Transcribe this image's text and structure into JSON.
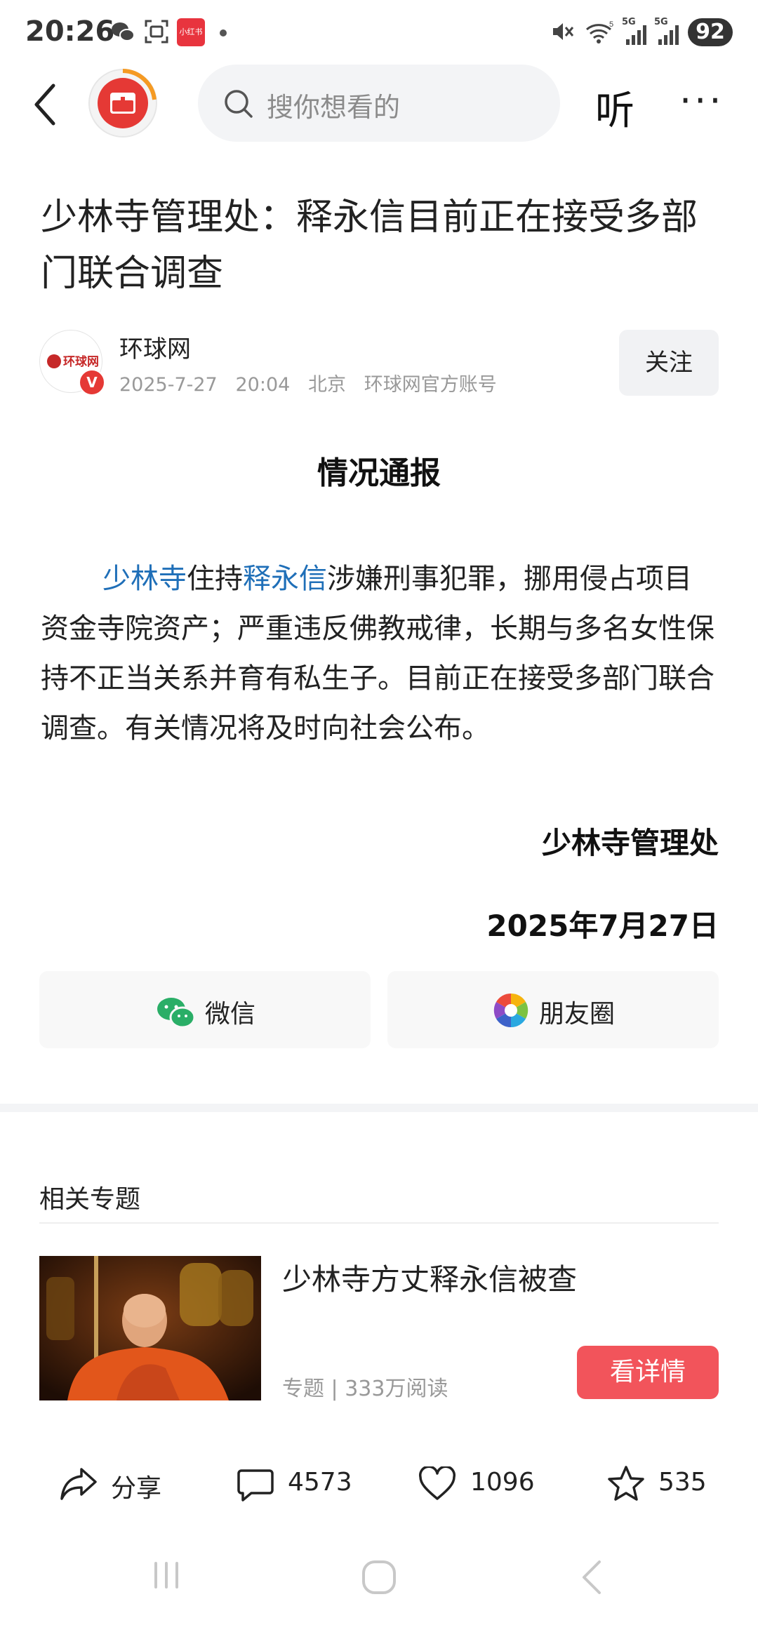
{
  "status_bar": {
    "time": "20:26",
    "app_badge": "小红书",
    "battery": "92",
    "signal_labels": [
      "5G",
      "5G"
    ],
    "icons": [
      "wechat-icon",
      "scan-icon",
      "xiaohongshu-icon",
      "dot-icon",
      "mute-icon",
      "wifi-icon",
      "signal-icon",
      "signal-icon",
      "battery-icon"
    ]
  },
  "top_nav": {
    "search_placeholder": "搜你想看的",
    "listen_label": "听",
    "more_label": "···"
  },
  "article": {
    "title": "少林寺管理处：释永信目前正在接受多部门联合调查",
    "author": {
      "name": "环球网",
      "logo_text": "环球网",
      "verified_badge": "V",
      "date": "2025-7-27",
      "time": "20:04",
      "location": "北京",
      "account_type": "环球网官方账号"
    },
    "follow_label": "关注",
    "heading": "情况通报",
    "paragraph": {
      "link1": "少林寺",
      "text1": "住持",
      "link2": "释永信",
      "text2": "涉嫌刑事犯罪，挪用侵占项目资金寺院资产；严重违反佛教戒律，长期与多名女性保持不正当关系并育有私生子。目前正在接受多部门联合调查。有关情况将及时向社会公布。"
    },
    "signature": "少林寺管理处",
    "sign_date": "2025年7月27日"
  },
  "share": {
    "wechat_label": "微信",
    "moments_label": "朋友圈"
  },
  "related": {
    "section_title": "相关专题",
    "topic_title": "少林寺方丈释永信被查",
    "topic_type": "专题",
    "topic_reads": "333万阅读",
    "detail_button": "看详情"
  },
  "actions": {
    "share_label": "分享",
    "comments": "4573",
    "likes": "1096",
    "favorites": "535"
  },
  "colors": {
    "link": "#1f6fb8",
    "accent": "#f2545b",
    "brand_red": "#e53935"
  }
}
